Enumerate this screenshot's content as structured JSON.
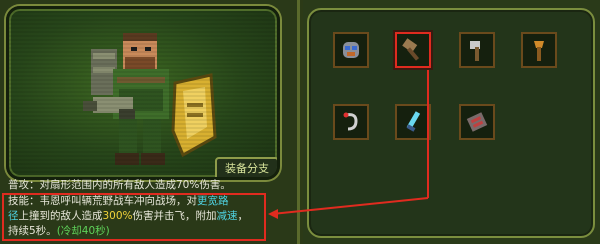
{
  "hero_panel": {
    "gear_branch_label": "装备分支",
    "normal_attack": {
      "prefix": "普攻：",
      "text": "对扇形范围内的所有敌人造成70%伤害。"
    },
    "skill": {
      "prefix": "技能：",
      "line1": "韦恩呼叫辆荒野战车冲向战场，对",
      "line1_hl": "更宽路",
      "line2_hl": "径",
      "line2_a": "上撞到的敌人造成",
      "line2_val": "300%",
      "line2_b": "伤害并击飞，附加",
      "line2_hl2": "减速",
      "line2_c": "，",
      "line3": "持续5秒。",
      "cooldown": "(冷却40秒)"
    }
  },
  "gear_slots": [
    {
      "icon": "mask-gear-icon"
    },
    {
      "icon": "hammer-gear-icon",
      "selected": true
    },
    {
      "icon": "axe-gear-icon"
    },
    {
      "icon": "torch-gear-icon"
    },
    {
      "icon": "hook-gear-icon"
    },
    {
      "icon": "blade-gear-icon"
    },
    {
      "icon": "engine-gear-icon"
    }
  ],
  "colors": {
    "highlight_red": "#e02b1f",
    "accent_green": "#5fd35a",
    "accent_cyan": "#4fd3e2",
    "accent_yellow": "#f0d23a"
  }
}
